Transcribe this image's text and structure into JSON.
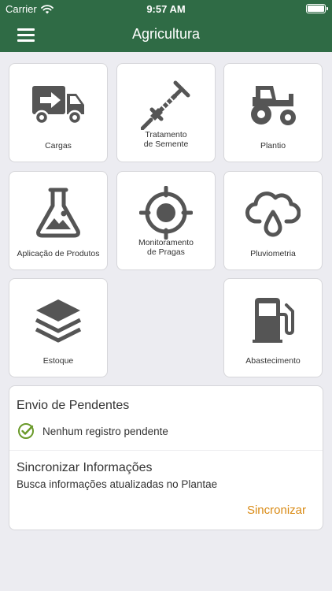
{
  "status_bar": {
    "carrier": "Carrier",
    "time": "9:57 AM"
  },
  "header": {
    "title": "Agricultura",
    "menu_icon": "hamburger-menu-icon",
    "background": "#2f6b45"
  },
  "tiles": [
    {
      "label": "Cargas",
      "icon": "delivery-truck-icon"
    },
    {
      "label": "Tratamento\nde Semente",
      "icon": "syringe-icon"
    },
    {
      "label": "Plantio",
      "icon": "tractor-icon"
    },
    {
      "label": "Aplicação de Produtos",
      "icon": "lab-flask-icon"
    },
    {
      "label": "Monitoramento\nde Pragas",
      "icon": "crosshair-target-icon"
    },
    {
      "label": "Pluviometria",
      "icon": "rain-cloud-icon"
    },
    {
      "label": "Estoque",
      "icon": "layers-stack-icon"
    },
    {
      "label": "Abastecimento",
      "icon": "fuel-pump-icon"
    }
  ],
  "pending": {
    "title": "Envio de Pendentes",
    "status": "Nenhum registro pendente",
    "status_icon": "check-circle-icon",
    "status_color": "#6a9a2a"
  },
  "sync": {
    "title": "Sincronizar Informações",
    "description": "Busca informações atualizadas no Plantae",
    "button_label": "Sincronizar",
    "button_color": "#d98a14"
  }
}
